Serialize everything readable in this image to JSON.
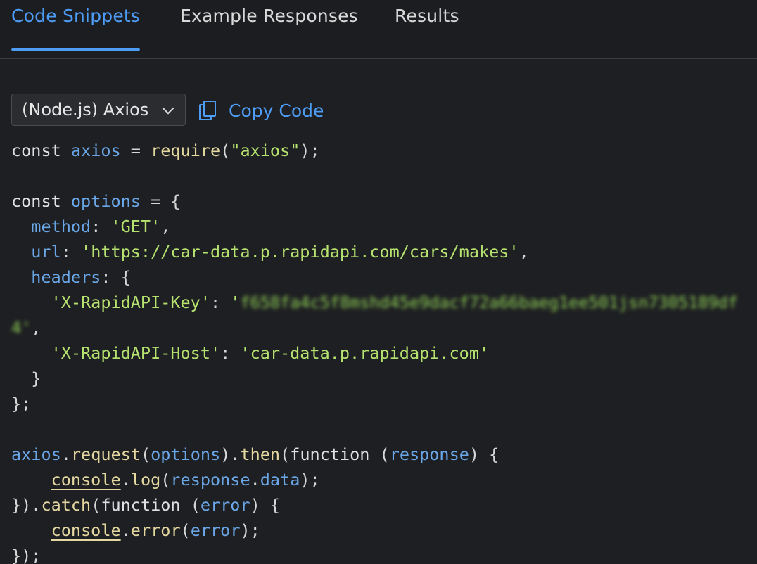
{
  "tabs": [
    {
      "label": "Code Snippets",
      "active": true
    },
    {
      "label": "Example Responses",
      "active": false
    },
    {
      "label": "Results",
      "active": false
    }
  ],
  "toolbar": {
    "language_value": "(Node.js) Axios",
    "copy_label": "Copy Code"
  },
  "code": {
    "axios_var": "axios",
    "require_str": "\"axios\"",
    "options_var": "options",
    "method_key": "method",
    "method_val": "'GET'",
    "url_key": "url",
    "url_val": "'https://car-data.p.rapidapi.com/cars/makes'",
    "headers_key": "headers",
    "key_header": "'X-RapidAPI-Key'",
    "key_value_redacted": "f658fa4c5f8mshd45e9dacf72a66baeg1ee501jsn7305189df",
    "key_value_tail": "4'",
    "host_header": "'X-RapidAPI-Host'",
    "host_val": "'car-data.p.rapidapi.com'",
    "response_var": "response",
    "error_var": "error"
  },
  "colors": {
    "accent": "#4d9df6",
    "background": "#1e1f22",
    "string": "#b6e36f",
    "identifier": "#6aa7e8",
    "function": "#e4d7a0"
  }
}
